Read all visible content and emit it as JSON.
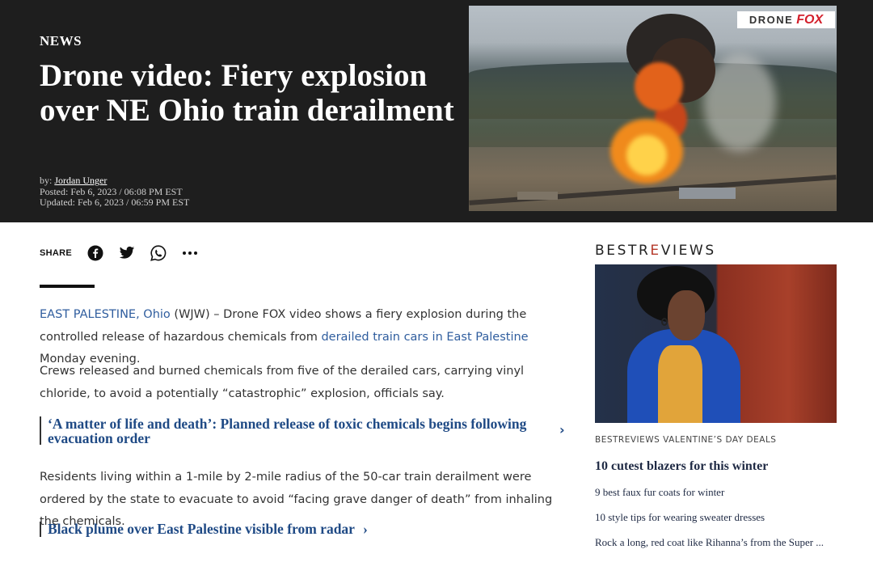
{
  "header": {
    "kicker": "NEWS",
    "headline": "Drone video: Fiery explosion over NE Ohio train derailment",
    "byline_prefix": "by:",
    "author": "Jordan Unger",
    "posted": "Posted: Feb 6, 2023 / 06:08 PM EST",
    "updated": "Updated: Feb 6, 2023 / 06:59 PM EST",
    "hero_logo_left": "DRONE",
    "hero_logo_right": "FOX"
  },
  "share": {
    "label": "SHARE",
    "icons": [
      "facebook-icon",
      "twitter-icon",
      "whatsapp-icon",
      "more-icon"
    ]
  },
  "article": {
    "p1": {
      "dateline_link": "EAST PALESTINE, Ohio",
      "text_a": " (WJW) – Drone FOX video shows a fiery explosion during the controlled release of hazardous chemicals from ",
      "inline_link": "derailed train cars in East Palestine",
      "text_b": " Monday evening."
    },
    "p2": "Crews released and burned chemicals from five of the derailed cars, carrying vinyl chloride, to avoid a potentially “catastrophic” explosion, officials say.",
    "related1": "‘A matter of life and death’: Planned release of toxic chemicals begins following evacuation order",
    "p3": "Residents living within a 1-mile by 2-mile radius of the 50-car train derailment were ordered by the state to evacuate to avoid “facing grave danger of death” from inhaling the chemicals.",
    "related2": "Black plume over East Palestine visible from radar"
  },
  "sidebar": {
    "logo_a": "BESTR",
    "logo_accent": "E",
    "logo_b": "VIEWS",
    "kicker": "BESTREVIEWS VALENTINE’S DAY DEALS",
    "headline": "10 cutest blazers for this winter",
    "items": [
      "9 best faux fur coats for winter",
      "10 style tips for wearing sweater dresses",
      "Rock a long, red coat like Rihanna’s from the Super ..."
    ]
  },
  "colors": {
    "header_bg": "#1e1e1e",
    "link": "#2f5d9e",
    "related_link": "#1f4a85",
    "brand_red": "#d3202c"
  }
}
